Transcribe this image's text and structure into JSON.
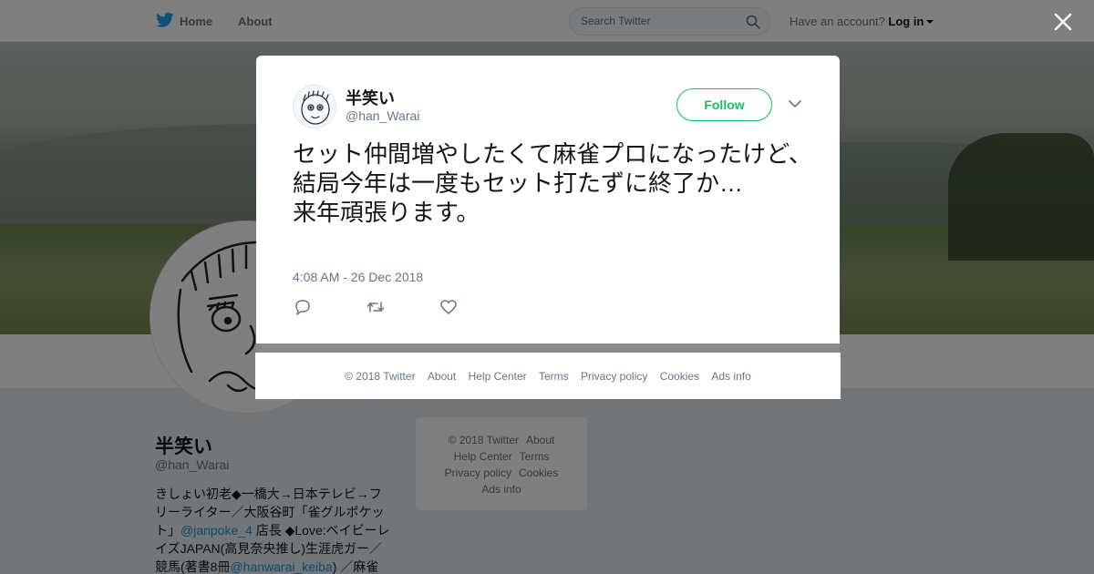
{
  "topbar": {
    "home_label": "Home",
    "about_label": "About",
    "search_placeholder": "Search Twitter",
    "account_prompt": "Have an account?",
    "login_label": "Log in"
  },
  "profile": {
    "name": "半笑い",
    "handle": "@han_Warai",
    "bio": [
      {
        "t": "きしょい初老◆一橋大→日本テレビ→フリーライター／大阪谷町「雀グルポケット」"
      },
      {
        "t": "@janpoke_4",
        "link": true
      },
      {
        "t": " 店長 ◆Love:ベイビーレイズJAPAN(高見奈央推し)生涯虎ガー／競馬(著書8冊"
      },
      {
        "t": "@hanwarai_keiba",
        "link": true
      },
      {
        "t": ") ／麻雀"
      }
    ]
  },
  "mini_footer": {
    "items": [
      "© 2018 Twitter",
      "About",
      "Help Center",
      "Terms",
      "Privacy policy",
      "Cookies",
      "Ads info"
    ]
  },
  "tweet": {
    "author_name": "半笑い",
    "author_handle": "@han_Warai",
    "follow_label": "Follow",
    "text": "セット仲間増やしたくて麻雀プロになったけど、結局今年は一度もセット打たずに終了か…\n来年頑張ります。",
    "timestamp": "4:08 AM - 26 Dec 2018"
  },
  "modal_footer": {
    "items": [
      "© 2018 Twitter",
      "About",
      "Help Center",
      "Terms",
      "Privacy policy",
      "Cookies",
      "Ads info"
    ]
  },
  "colors": {
    "accent_blue": "#1da1f2",
    "follow_green": "#17bf63",
    "link_blue": "#1b95e0",
    "muted_text": "#657786"
  },
  "icons": [
    "twitter-bird-icon",
    "search-icon",
    "close-icon",
    "chevron-down-icon",
    "reply-icon",
    "retweet-icon",
    "like-icon"
  ]
}
